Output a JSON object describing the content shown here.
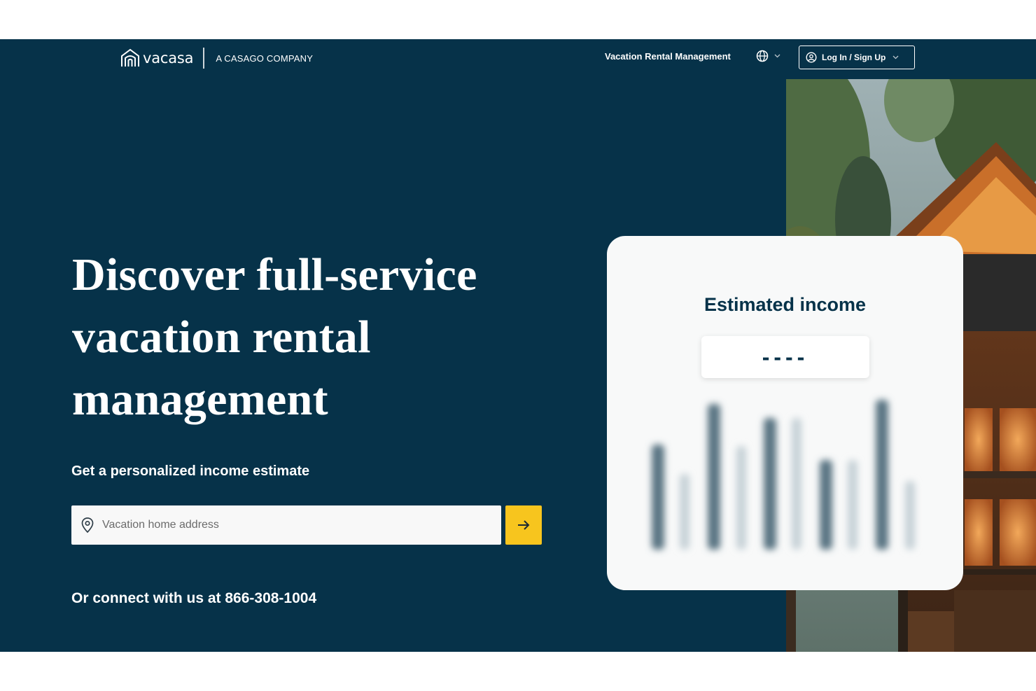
{
  "brand": {
    "name": "vacasa",
    "tagline": "A CASAGO COMPANY"
  },
  "nav": {
    "link": "Vacation Rental Management",
    "language_icon": "globe-icon",
    "login_label": "Log In / Sign Up",
    "login_icon": "user-circle-icon"
  },
  "hero": {
    "headline": "Discover full-service vacation rental management",
    "subhead": "Get a personalized income estimate",
    "search_placeholder": "Vacation home address",
    "search_icon": "map-pin-icon",
    "submit_icon": "arrow-right-icon",
    "connect": "Or connect with us at 866-308-1004"
  },
  "card": {
    "title": "Estimated income",
    "value": "----"
  },
  "colors": {
    "background": "#063249",
    "accent": "#f7c51e",
    "card": "#f8f9f9"
  }
}
